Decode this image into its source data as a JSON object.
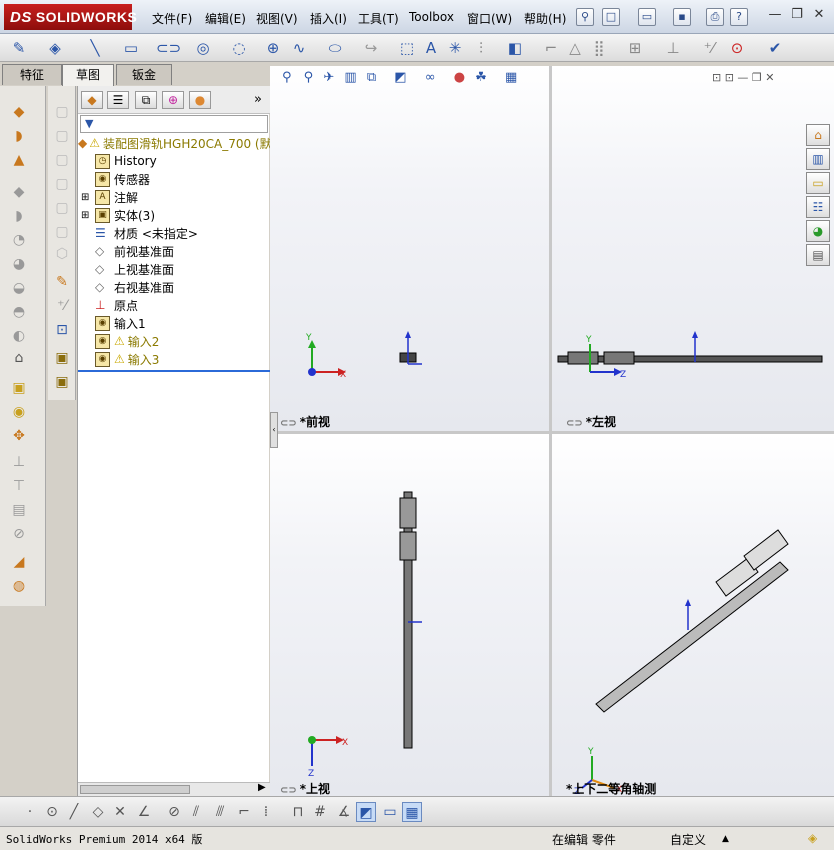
{
  "app": {
    "logo_prefix": "DS",
    "logo_text": "SOLIDWORKS"
  },
  "menu": [
    "文件(F)",
    "编辑(E)",
    "视图(V)",
    "插入(I)",
    "工具(T)",
    "Toolbox",
    "窗口(W)",
    "帮助(H)"
  ],
  "tabs": [
    "特征",
    "草图",
    "钣金"
  ],
  "tree": {
    "root": "装配图滑轨HGH20CA_700 (默",
    "items": [
      {
        "label": "History",
        "icon": "history-icon"
      },
      {
        "label": "传感器",
        "icon": "sensor-icon"
      },
      {
        "label": "注解",
        "icon": "annotation-icon"
      },
      {
        "label": "实体(3)",
        "icon": "solid-bodies-icon"
      },
      {
        "label": "材质 <未指定>",
        "icon": "material-icon"
      },
      {
        "label": "前视基准面",
        "icon": "plane-icon"
      },
      {
        "label": "上视基准面",
        "icon": "plane-icon"
      },
      {
        "label": "右视基准面",
        "icon": "plane-icon"
      },
      {
        "label": "原点",
        "icon": "origin-icon"
      },
      {
        "label": "输入1",
        "icon": "import-icon"
      },
      {
        "label": "输入2",
        "icon": "import-warning-icon"
      },
      {
        "label": "输入3",
        "icon": "import-warning-icon"
      }
    ]
  },
  "views": {
    "front": "*前视",
    "left": "*左视",
    "top": "*上视",
    "iso": "*上下二等角轴测"
  },
  "axes": {
    "x": "X",
    "y": "Y",
    "z": "Z"
  },
  "status": {
    "version": "SolidWorks Premium 2014 x64 版",
    "mode": "在编辑 零件",
    "units": "自定义",
    "units_caret": "▲"
  },
  "colors": {
    "logo_red": "#b01a18",
    "axis_x": "#cc2222",
    "axis_y": "#22aa22",
    "axis_z": "#2233cc"
  }
}
